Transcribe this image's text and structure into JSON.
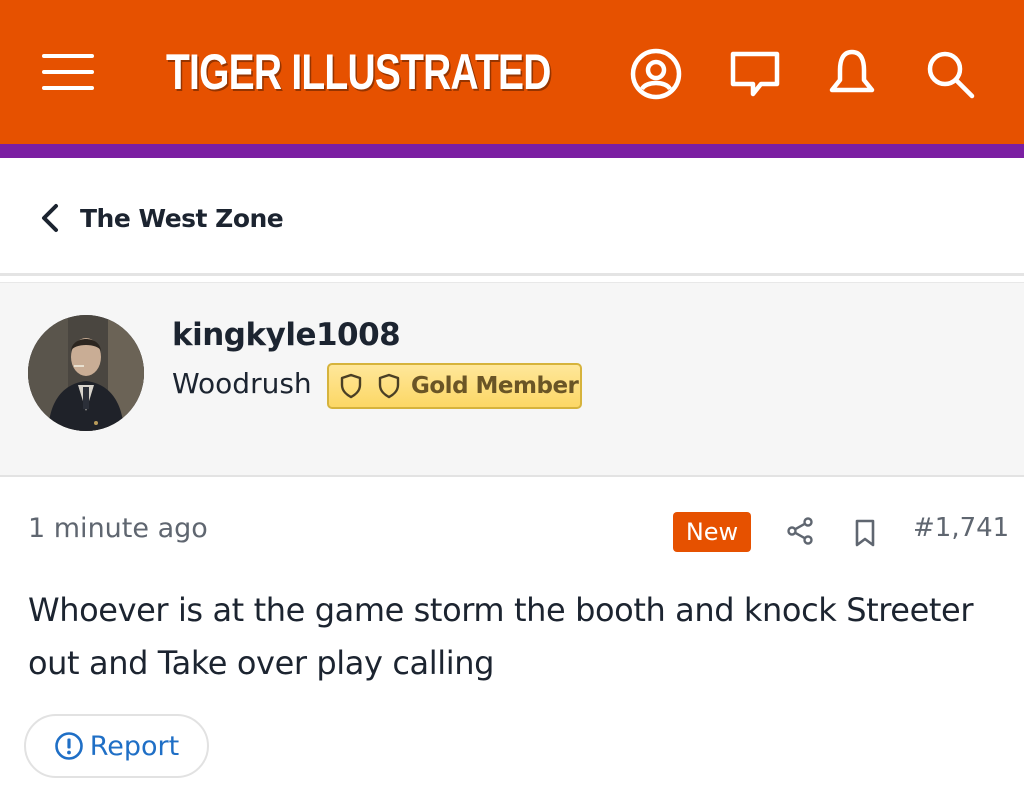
{
  "header": {
    "brand": "TIGER ILLUSTRATED",
    "accent_color": "#e65100",
    "strip_color": "#7b1fa2",
    "icons": [
      "menu-icon",
      "profile-icon",
      "chat-icon",
      "bell-icon",
      "search-icon"
    ]
  },
  "breadcrumb": {
    "back_label": "The West Zone"
  },
  "author": {
    "username": "kingkyle1008",
    "title": "Woodrush",
    "badge_label": "Gold Member",
    "badge_color": "#fcd765"
  },
  "post": {
    "timestamp": "1 minute ago",
    "new_label": "New",
    "post_number": "#1,741",
    "body": "Whoever is at the game storm the booth and knock Streeter out and Take over play calling"
  },
  "actions": {
    "report_label": "Report",
    "report_color": "#1f6fc6"
  }
}
